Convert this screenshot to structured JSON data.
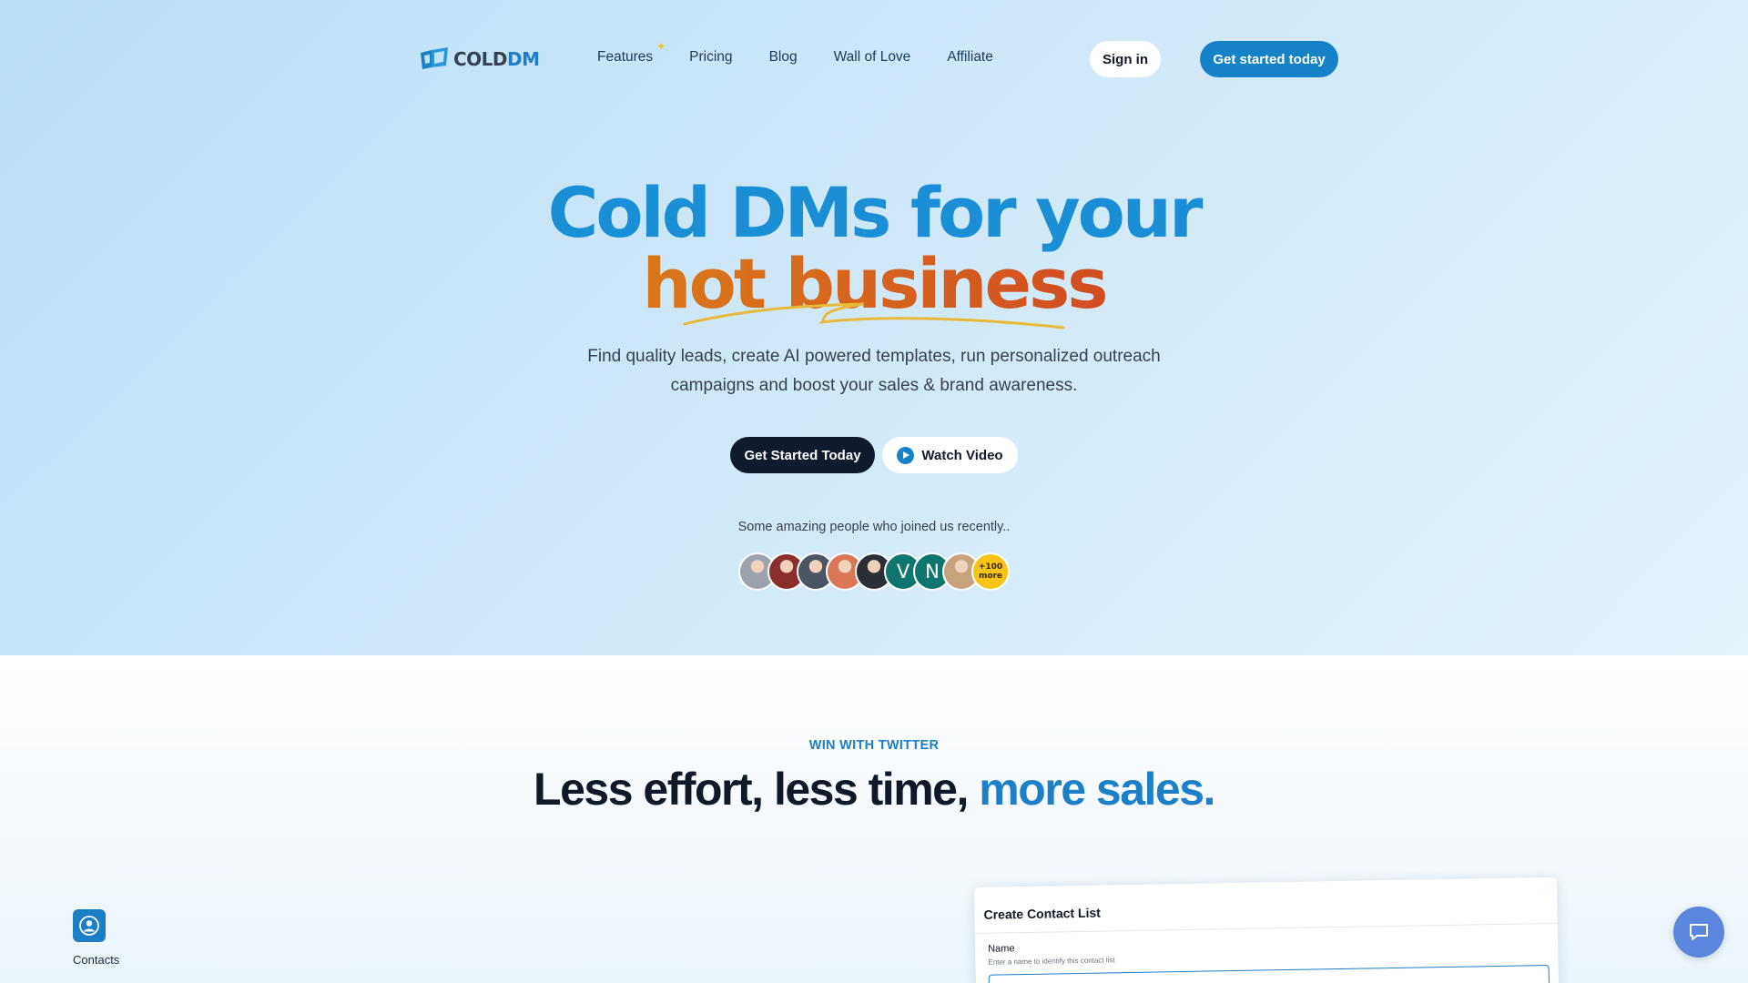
{
  "brand": {
    "logo_text_a": "COLD",
    "logo_text_b": "DM"
  },
  "nav": {
    "items": [
      "Features",
      "Pricing",
      "Blog",
      "Wall of Love",
      "Affiliate"
    ],
    "sign_in": "Sign in",
    "cta": "Get started today"
  },
  "hero": {
    "headline_line1": "Cold DMs for your",
    "headline_line2": "hot business",
    "subtitle_line1": "Find quality leads, create AI powered templates, run personalized outreach",
    "subtitle_line2": "campaigns and boost your sales & brand awareness.",
    "primary_button": "Get Started Today",
    "video_button": "Watch Video",
    "joined_text": "Some amazing people who joined us recently..",
    "avatars": [
      {
        "type": "photo",
        "color": "#9ca3af"
      },
      {
        "type": "photo",
        "color": "#8b2e2e"
      },
      {
        "type": "photo",
        "color": "#4b5563"
      },
      {
        "type": "photo",
        "color": "#d97757"
      },
      {
        "type": "photo",
        "color": "#2b2f36"
      },
      {
        "type": "initial",
        "letter": "V",
        "color": "#0f766e"
      },
      {
        "type": "initial",
        "letter": "N",
        "color": "#0f766e"
      },
      {
        "type": "photo",
        "color": "#c8a27a"
      }
    ],
    "more_badge_line1": "+100",
    "more_badge_line2": "more"
  },
  "section": {
    "eyebrow": "WIN WITH TWITTER",
    "title_main": "Less effort, less time,",
    "title_accent": "more sales."
  },
  "contacts_tile": {
    "label": "Contacts",
    "icon": "contacts-icon"
  },
  "card": {
    "title": "Create Contact List",
    "field_label": "Name",
    "field_help": "Enter a name to identify this contact list"
  },
  "chat": {
    "icon": "chat-bubble-icon"
  },
  "colors": {
    "accent": "#1582c8",
    "headline_blue": "#1a8fd6",
    "dark_button": "#0f1b2d",
    "badge_yellow": "#f7c316"
  }
}
